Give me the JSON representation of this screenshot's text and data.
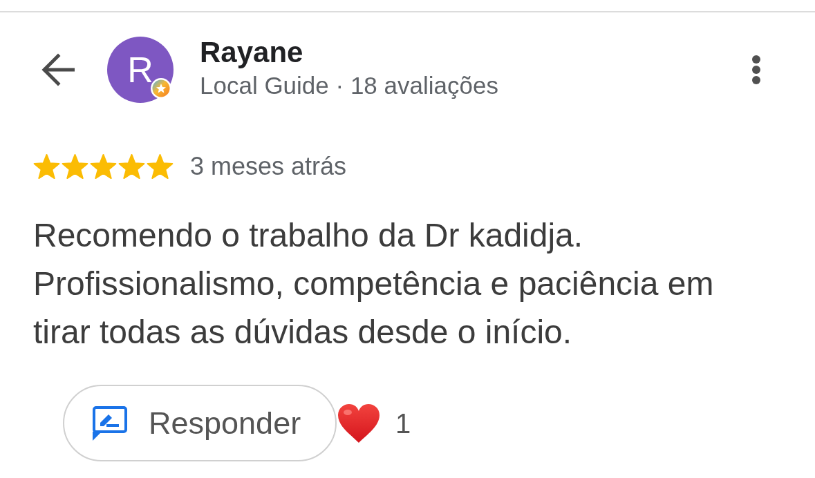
{
  "reviewer": {
    "avatar_initial": "R",
    "local_guide_badge": true,
    "name": "Rayane",
    "meta": "Local Guide · 18 avaliações"
  },
  "review": {
    "stars": 5,
    "time": "3 meses atrás",
    "text": "Recomendo o trabalho da Dr kadidja. Profissionalismo, competência e paciência em tirar todas as dúvidas desde o início."
  },
  "actions": {
    "reply_button": "Responder",
    "reaction_count": "1"
  }
}
